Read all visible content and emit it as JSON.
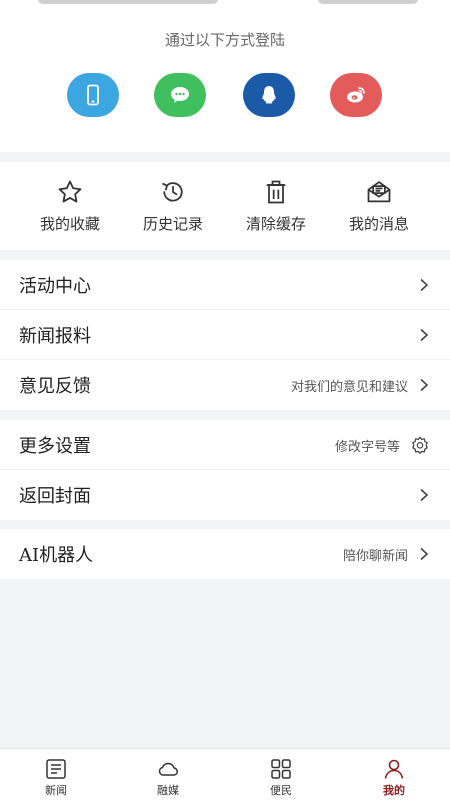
{
  "login": {
    "title": "通过以下方式登陆",
    "providers": [
      {
        "name": "phone",
        "color": "#3ca6e0"
      },
      {
        "name": "wechat",
        "color": "#3fbf5e"
      },
      {
        "name": "qq",
        "color": "#1a5aa7"
      },
      {
        "name": "weibo",
        "color": "#e35b5b"
      }
    ]
  },
  "quick_actions": [
    {
      "label": "我的收藏",
      "icon": "star-icon"
    },
    {
      "label": "历史记录",
      "icon": "history-icon"
    },
    {
      "label": "清除缓存",
      "icon": "trash-icon"
    },
    {
      "label": "我的消息",
      "icon": "mail-icon"
    }
  ],
  "menu_groups": [
    [
      {
        "title": "活动中心",
        "hint": ""
      },
      {
        "title": "新闻报料",
        "hint": ""
      },
      {
        "title": "意见反馈",
        "hint": "对我们的意见和建议"
      }
    ],
    [
      {
        "title": "更多设置",
        "hint": "修改字号等"
      },
      {
        "title": "返回封面",
        "hint": ""
      }
    ],
    [
      {
        "title": "AI机器人",
        "hint": "陪你聊新闻"
      }
    ]
  ],
  "tabbar": {
    "tabs": [
      {
        "label": "新闻",
        "icon": "news-list-icon"
      },
      {
        "label": "融媒",
        "icon": "cloud-icon"
      },
      {
        "label": "便民",
        "icon": "grid-icon"
      },
      {
        "label": "我的",
        "icon": "person-icon"
      }
    ],
    "active_tab": "我的",
    "active_color": "#8b1c1c"
  }
}
